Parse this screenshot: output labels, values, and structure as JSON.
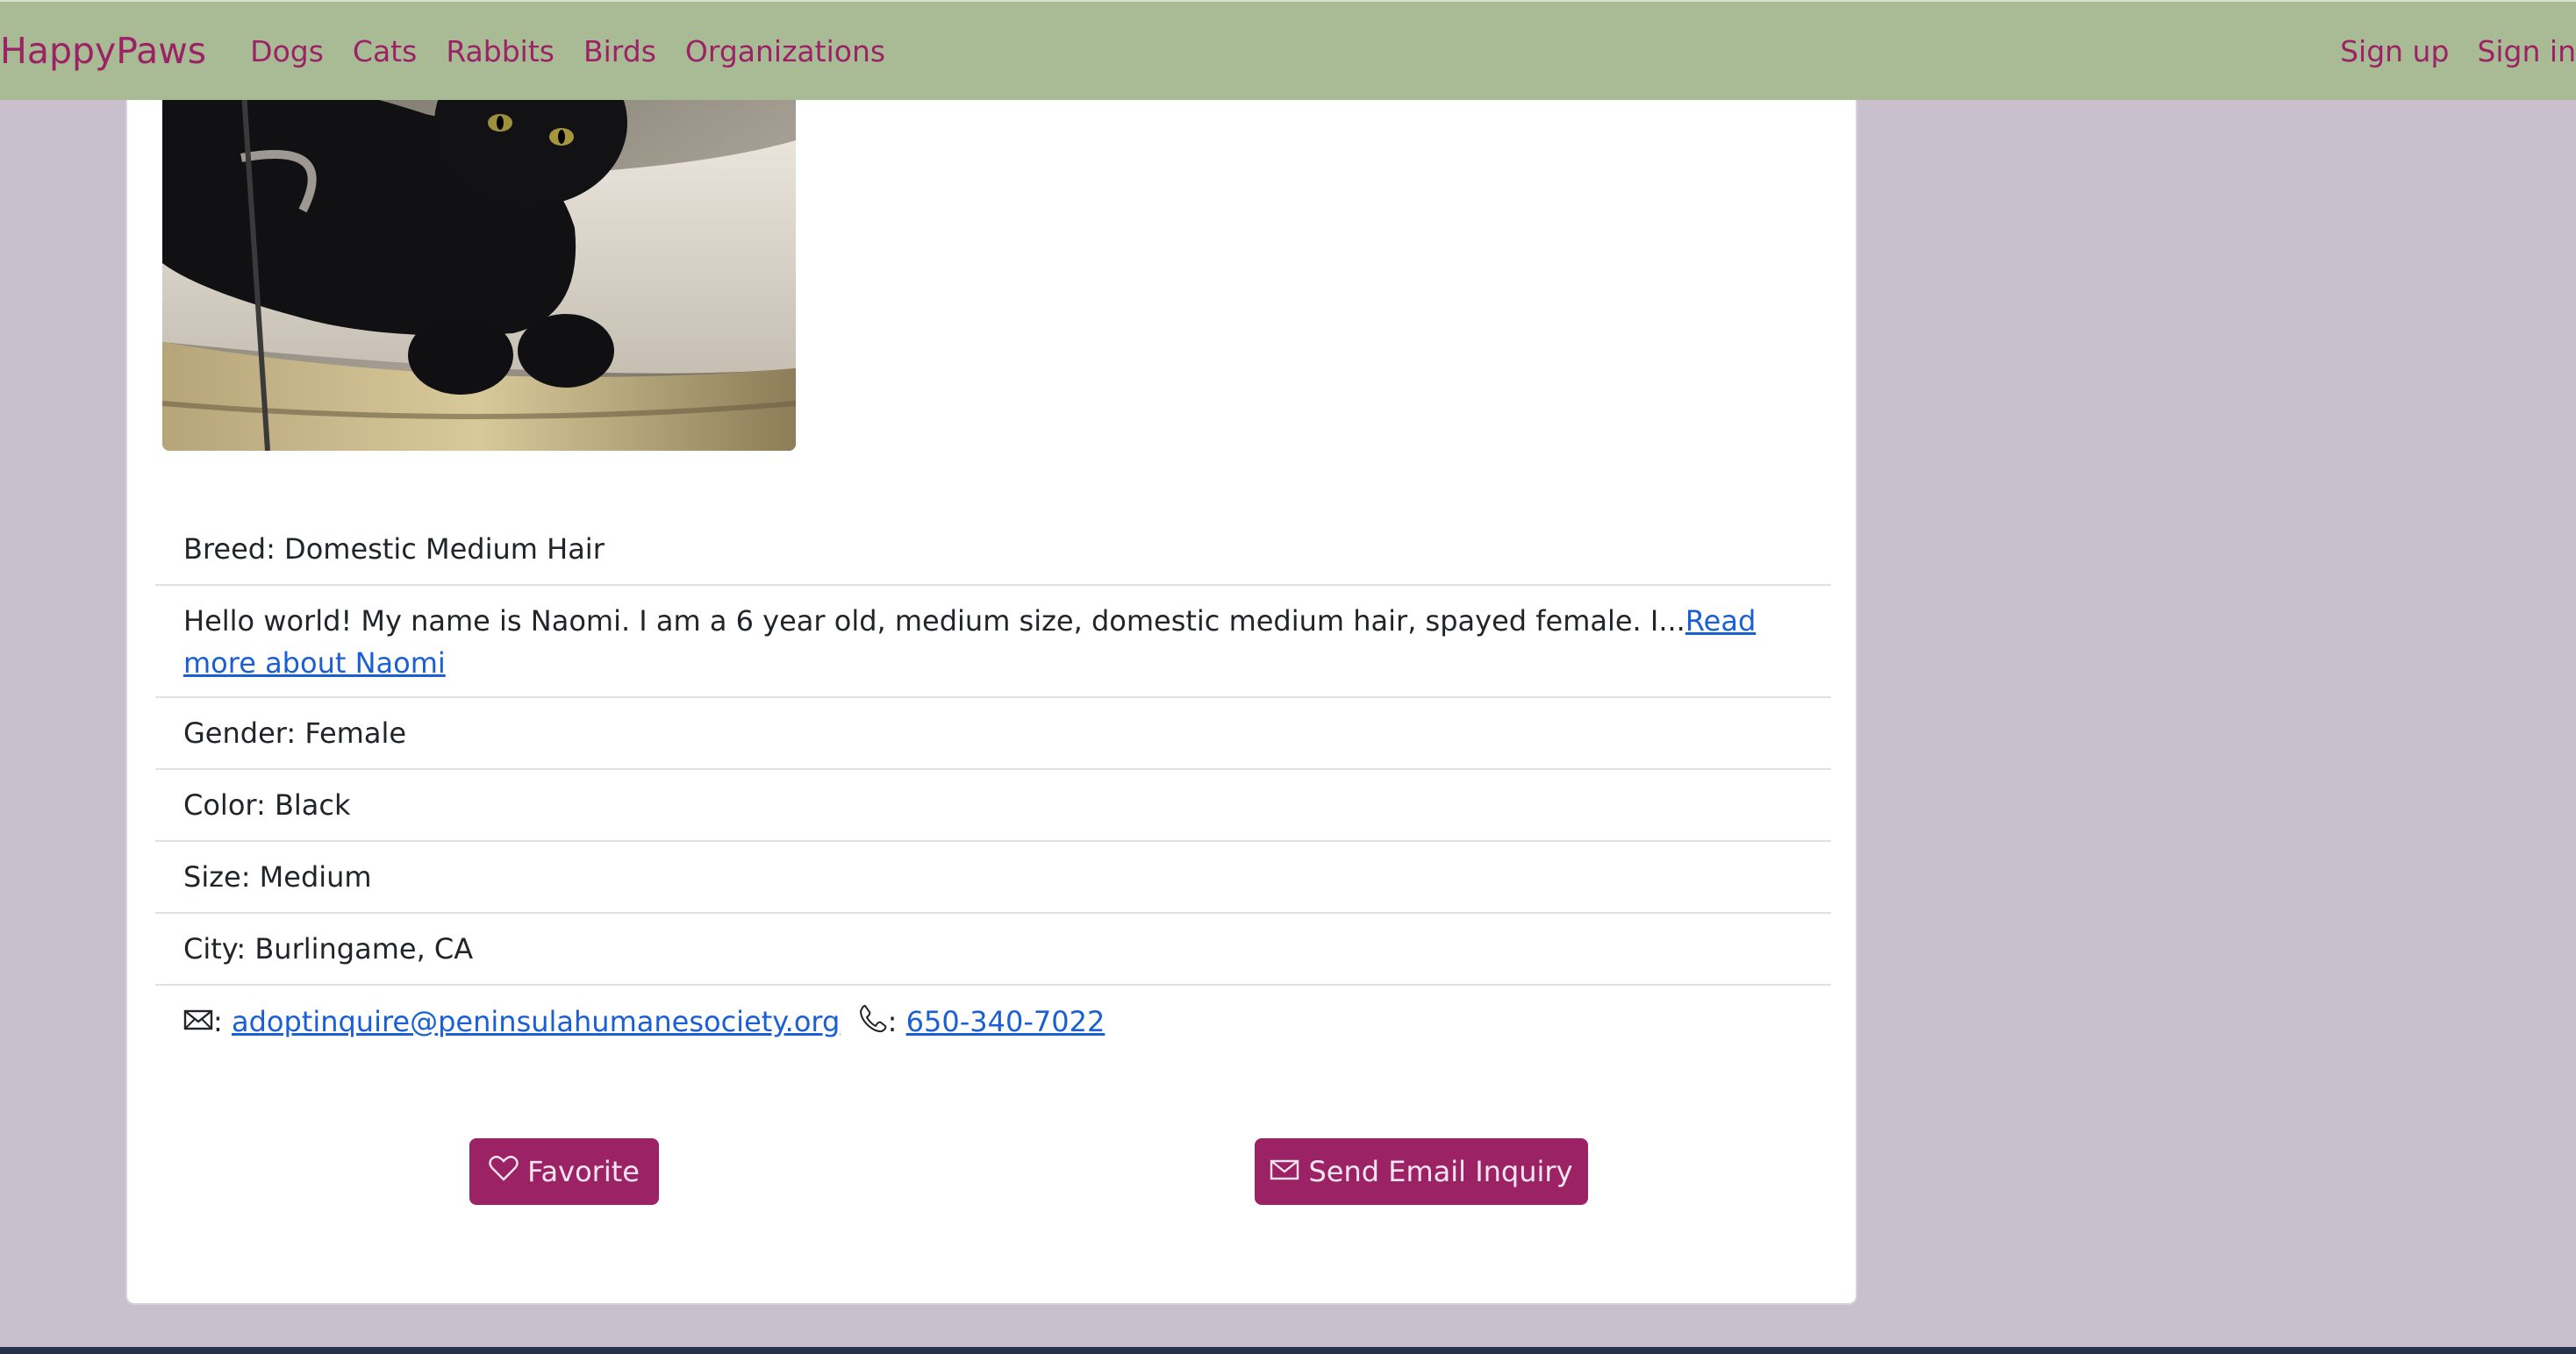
{
  "nav": {
    "brand": "HappyPaws",
    "links": [
      "Dogs",
      "Cats",
      "Rabbits",
      "Birds",
      "Organizations"
    ],
    "signup": "Sign up",
    "signin": "Sign in"
  },
  "pet": {
    "photo_icon": "cat-photo",
    "breed": "Breed: Domestic Medium Hair",
    "description": "Hello world! My name is Naomi. I am a 6 year old, medium size, domestic medium hair, spayed female. I...",
    "read_more": "Read more about Naomi",
    "gender": "Gender: Female",
    "color": "Color: Black",
    "size": "Size: Medium",
    "city": "City: Burlingame, CA",
    "email": "adoptinquire@peninsulahumanesociety.org",
    "phone": "650-340-7022",
    "sep": ":"
  },
  "buttons": {
    "favorite": "Favorite",
    "email_inquiry": "Send Email Inquiry"
  },
  "colors": {
    "navbar": "#a8bb94",
    "accent": "#9c2266",
    "page_bg": "#c9bfcd",
    "link": "#1a5fd6"
  },
  "icons": {
    "email": "envelope-icon",
    "phone": "phone-icon",
    "favorite": "heart-icon"
  }
}
